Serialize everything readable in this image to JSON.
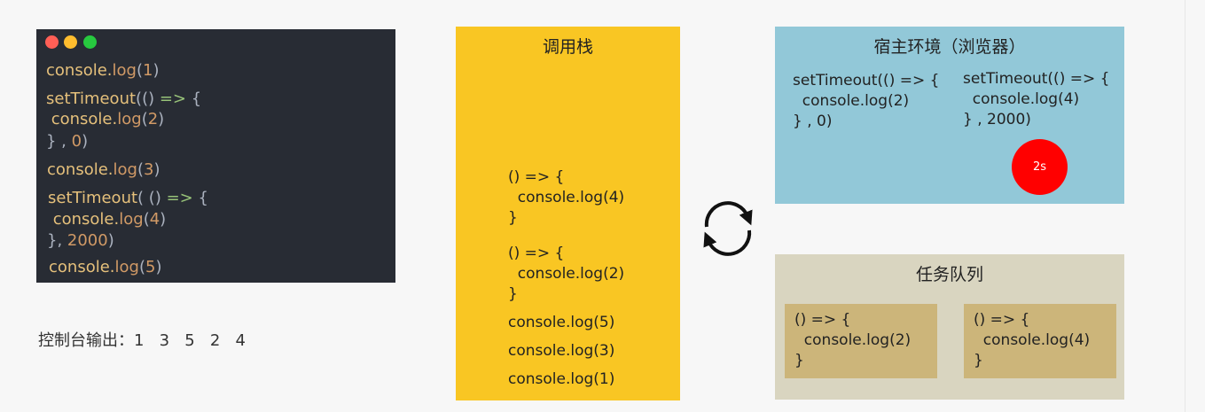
{
  "editor": {
    "dot_colors": [
      "#ff5f56",
      "#ffbd2e",
      "#27c93f"
    ],
    "lines": [
      [
        {
          "t": "console.",
          "c": "y"
        },
        {
          "t": "log",
          "c": "o"
        },
        {
          "t": "(",
          "c": "w"
        },
        {
          "t": "1",
          "c": "o"
        },
        {
          "t": ")",
          "c": "w"
        }
      ],
      [
        {
          "t": "setTimeout",
          "c": "y"
        },
        {
          "t": "(() ",
          "c": "w"
        },
        {
          "t": "=>",
          "c": "g"
        },
        {
          "t": " {",
          "c": "w"
        }
      ],
      [
        {
          "t": " console.",
          "c": "y"
        },
        {
          "t": "log",
          "c": "o"
        },
        {
          "t": "(",
          "c": "w"
        },
        {
          "t": "2",
          "c": "o"
        },
        {
          "t": ")",
          "c": "w"
        }
      ],
      [
        {
          "t": "} , ",
          "c": "w"
        },
        {
          "t": "0",
          "c": "o"
        },
        {
          "t": ")",
          "c": "w"
        }
      ],
      [
        {
          "t": "console.",
          "c": "y"
        },
        {
          "t": "log",
          "c": "o"
        },
        {
          "t": "(",
          "c": "w"
        },
        {
          "t": "3",
          "c": "o"
        },
        {
          "t": ")",
          "c": "w"
        }
      ],
      [
        {
          "t": "setTimeout",
          "c": "y"
        },
        {
          "t": "( () ",
          "c": "w"
        },
        {
          "t": "=>",
          "c": "g"
        },
        {
          "t": " {",
          "c": "w"
        }
      ],
      [
        {
          "t": " console.",
          "c": "y"
        },
        {
          "t": "log",
          "c": "o"
        },
        {
          "t": "(",
          "c": "w"
        },
        {
          "t": "4",
          "c": "o"
        },
        {
          "t": ")",
          "c": "w"
        }
      ],
      [
        {
          "t": "}, ",
          "c": "w"
        },
        {
          "t": "2000",
          "c": "o"
        },
        {
          "t": ")",
          "c": "w"
        }
      ],
      [
        {
          "t": "console.",
          "c": "y"
        },
        {
          "t": "log",
          "c": "o"
        },
        {
          "t": "(",
          "c": "w"
        },
        {
          "t": "5",
          "c": "o"
        },
        {
          "t": ")",
          "c": "w"
        }
      ]
    ]
  },
  "console_output": "控制台输出：1   3   5   2   4",
  "call_stack": {
    "title": "调用栈",
    "frames": [
      "() => {\n  console.log(4)\n}",
      "() => {\n  console.log(2)\n}",
      "console.log(5)",
      "console.log(3)",
      "console.log(1)"
    ]
  },
  "host": {
    "title": "宿主环境（浏览器）",
    "timers": [
      "setTimeout(() => {\n  console.log(2)\n} , 0)",
      "setTimeout(() => {\n  console.log(4)\n} , 2000)"
    ],
    "timer_badge": "2s"
  },
  "task_queue": {
    "title": "任务队列",
    "tasks": [
      "() => {\n  console.log(2)\n}",
      "() => {\n  console.log(4)\n}"
    ]
  },
  "colors": {
    "stack_bg": "#f9c623",
    "host_bg": "#92c8d8",
    "queue_bg": "#d9d5c0",
    "task_bg": "#ccb57a",
    "timer_badge": "#ff0000"
  }
}
